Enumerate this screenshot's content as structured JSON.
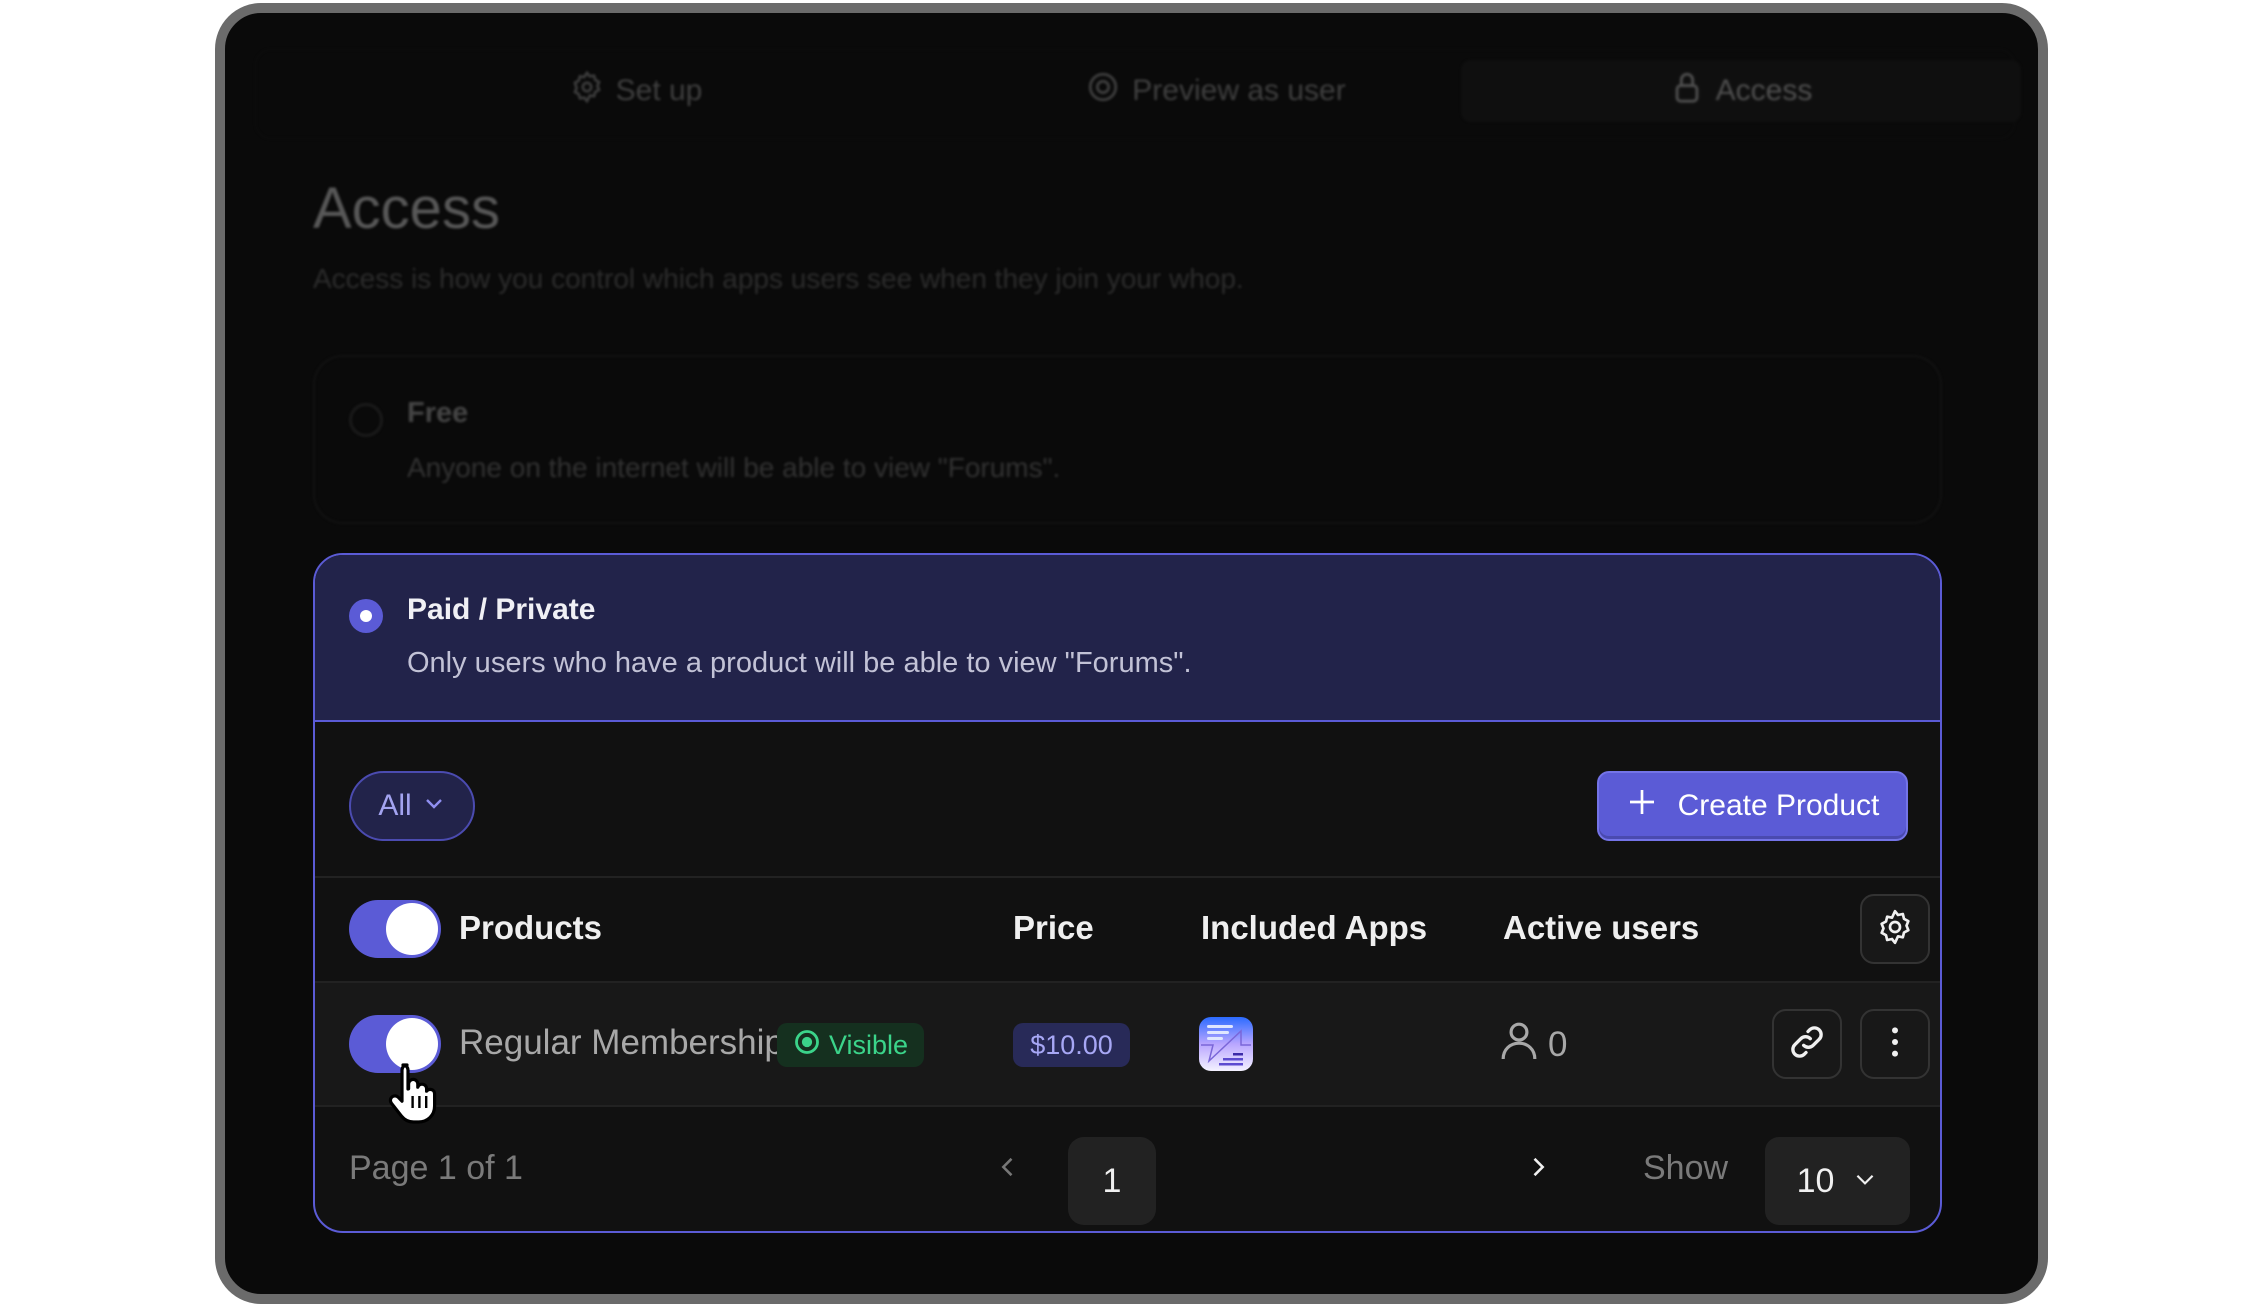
{
  "tabs": [
    {
      "label": "Set up",
      "icon": "gear-icon",
      "active": false
    },
    {
      "label": "Preview as user",
      "icon": "eye-icon",
      "active": false
    },
    {
      "label": "Access",
      "icon": "lock-icon",
      "active": true
    }
  ],
  "page": {
    "title": "Access",
    "subtitle": "Access is how you control which apps users see when they join your whop."
  },
  "access_options": {
    "free": {
      "title": "Free",
      "description": "Anyone on the internet will be able to view \"Forums\".",
      "selected": false
    },
    "paid": {
      "title": "Paid / Private",
      "description": "Only users who have a product will be able to view \"Forums\".",
      "selected": true
    }
  },
  "toolbar": {
    "filter_label": "All",
    "create_label": "Create Product"
  },
  "table": {
    "columns": [
      "Products",
      "Price",
      "Included Apps",
      "Active users"
    ],
    "select_all_on": true,
    "rows": [
      {
        "name": "Regular Membership",
        "enabled": true,
        "status": "Visible",
        "price": "$10.00",
        "apps": [
          "forums-app-icon"
        ],
        "active_users": "0"
      }
    ]
  },
  "pagination": {
    "info": "Page 1 of 1",
    "current": "1",
    "show_label": "Show",
    "page_size": "10"
  },
  "colors": {
    "accent": "#5b5bd6",
    "paid_header_bg": "#22234a",
    "visible_green": "#3bd48a",
    "frame_border": "#6b6b6b"
  }
}
